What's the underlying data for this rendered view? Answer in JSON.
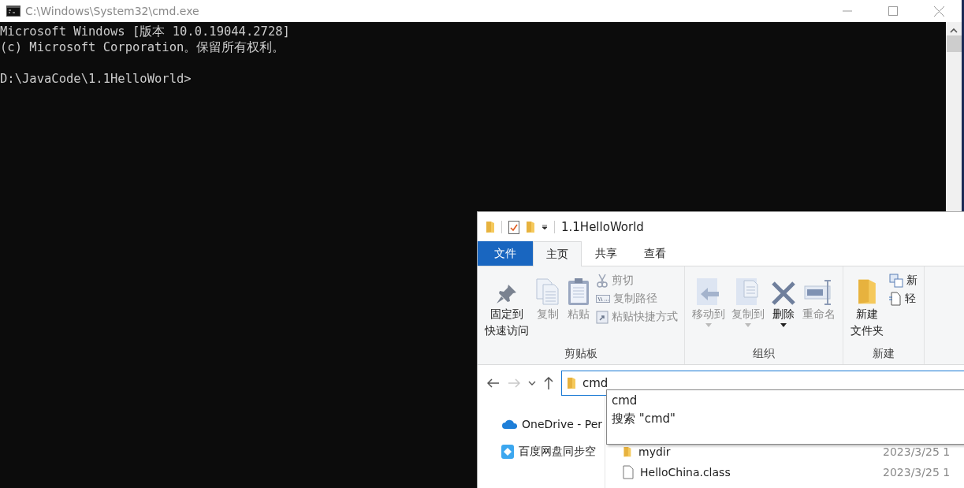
{
  "cmd_window": {
    "title": "C:\\Windows\\System32\\cmd.exe",
    "lines": [
      "Microsoft Windows [版本 10.0.19044.2728]",
      "(c) Microsoft Corporation。保留所有权利。"
    ],
    "prompt": "D:\\JavaCode\\1.1HelloWorld>"
  },
  "explorer": {
    "title": "1.1HelloWorld",
    "tabs": [
      {
        "label": "文件",
        "kind": "file",
        "selected": false
      },
      {
        "label": "主页",
        "kind": "tab",
        "selected": true
      },
      {
        "label": "共享",
        "kind": "tab",
        "selected": false
      },
      {
        "label": "查看",
        "kind": "tab",
        "selected": false
      }
    ],
    "ribbon_groups": [
      {
        "label": "剪贴板",
        "items": [
          {
            "kind": "large",
            "label_lines": [
              "固定到",
              "快速访问"
            ],
            "disabled": false,
            "has_menu": false
          },
          {
            "kind": "large",
            "label": "复制",
            "disabled": true,
            "has_menu": false
          },
          {
            "kind": "large",
            "label": "粘贴",
            "disabled": true,
            "has_menu": false
          },
          {
            "kind": "small",
            "label": "剪切",
            "disabled": true
          },
          {
            "kind": "small",
            "label": "复制路径",
            "disabled": true
          },
          {
            "kind": "small",
            "label": "粘贴快捷方式",
            "disabled": true
          }
        ]
      },
      {
        "label": "组织",
        "items": [
          {
            "kind": "large",
            "label": "移动到",
            "disabled": true,
            "has_menu": true
          },
          {
            "kind": "large",
            "label": "复制到",
            "disabled": true,
            "has_menu": true
          },
          {
            "kind": "large",
            "label": "删除",
            "disabled": false,
            "has_menu": true
          },
          {
            "kind": "large",
            "label": "重命名",
            "disabled": true,
            "has_menu": false
          }
        ]
      },
      {
        "label": "新建",
        "items": [
          {
            "kind": "large",
            "label_lines": [
              "新建",
              "文件夹"
            ],
            "disabled": false,
            "has_menu": false
          },
          {
            "kind": "small",
            "label": "新",
            "disabled": false
          },
          {
            "kind": "small",
            "label": "轻",
            "disabled": false
          }
        ]
      }
    ],
    "address": {
      "value": "cmd",
      "suggestions": [
        "cmd",
        "搜索 \"cmd\""
      ]
    },
    "nav_pane": [
      "OneDrive - Per",
      "百度网盘同步空"
    ],
    "files": [
      {
        "name": "mydir",
        "kind": "folder",
        "date": "2023/3/25 1"
      },
      {
        "name": "HelloChina.class",
        "kind": "file",
        "date": "2023/3/25 1"
      }
    ]
  }
}
